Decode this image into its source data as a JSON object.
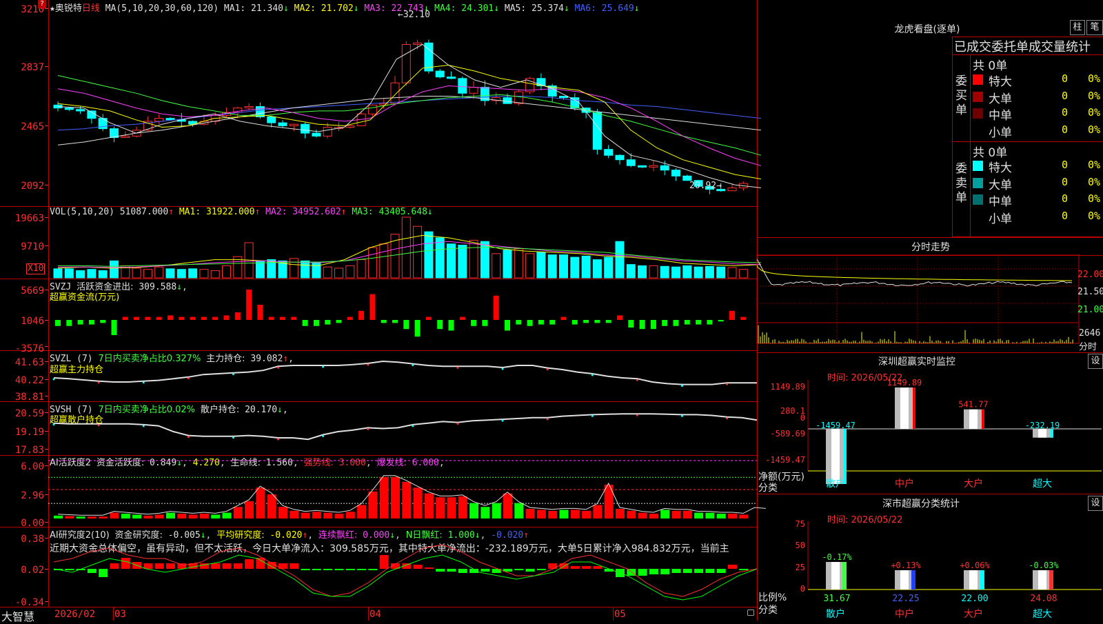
{
  "main": {
    "title_star": "★",
    "stock_name": "奥锐特",
    "period": "日线",
    "ma_label": "MA(5,10,20,30,60,120)",
    "ma": [
      {
        "name": "MA1",
        "value": "21.340",
        "arrow": "↓",
        "color": "#e0e0e0"
      },
      {
        "name": "MA2",
        "value": "21.702",
        "arrow": "↓",
        "color": "#ffff00"
      },
      {
        "name": "MA3",
        "value": "22.743",
        "arrow": "↓",
        "color": "#ff40ff"
      },
      {
        "name": "MA4",
        "value": "24.301",
        "arrow": "↓",
        "color": "#40ff40"
      },
      {
        "name": "MA5",
        "value": "25.374",
        "arrow": "↓",
        "color": "#e0e0e0"
      },
      {
        "name": "MA6",
        "value": "25.649",
        "arrow": "↓",
        "color": "#4060ff"
      }
    ],
    "y_labels": [
      "3210",
      "2837",
      "2465",
      "2092"
    ],
    "max_annot": "32.10",
    "min_annot": "20.92"
  },
  "vol": {
    "label": "VOL(5,10,20)",
    "value": "51087.000",
    "value_arrow": "↑",
    "ma": [
      {
        "name": "MA1",
        "value": "31922.000",
        "arrow": "↑",
        "color": "#ffff00"
      },
      {
        "name": "MA2",
        "value": "34952.602",
        "arrow": "↑",
        "color": "#ff40ff"
      },
      {
        "name": "MA3",
        "value": "43405.648",
        "arrow": "↓",
        "color": "#40ff40"
      }
    ],
    "y_labels": [
      "19663",
      "9710"
    ],
    "unit": "X10"
  },
  "svzj": {
    "label": "SVZJ",
    "text": "活跃资金进出:",
    "value": "309.588",
    "arrow": "↓",
    "sub": "超赢资金流(万元)",
    "y_labels": [
      "5669",
      "1046",
      "-3576"
    ]
  },
  "svzl": {
    "label": "SVZL (7)",
    "text1": "7日内买卖净占比0.327%",
    "text2": "主力持仓:",
    "value": "39.082",
    "arrow": "↑",
    "suffix": ",",
    "sub": "超赢主力持仓",
    "y_labels": [
      "41.63",
      "40.22",
      "38.81"
    ]
  },
  "svsh": {
    "label": "SVSH (7)",
    "text1": "7日内买卖净占比0.02%",
    "text2": "散户持仓:",
    "value": "20.170",
    "arrow": "↓",
    "suffix": ",",
    "sub": "超赢散户持仓",
    "y_labels": [
      "20.59",
      "19.19",
      "17.83"
    ]
  },
  "ai_active": {
    "label": "AI活跃度2",
    "text": "资金活跃度:",
    "v1": "0.849",
    "a1": "↓",
    "v2": "4.270",
    "t2": "生命线:",
    "v3": "1.560",
    "t3": "强势线:",
    "v4": "3.000",
    "t4": "爆发线:",
    "v5": "6.000",
    "y_labels": [
      "6.00",
      "2.96",
      "0.00"
    ]
  },
  "ai_research": {
    "label": "AI研究度2(10)",
    "t1": "资金研究度:",
    "v1": "-0.005",
    "a1": "↓",
    "t2": "平均研究度:",
    "v2": "-0.020",
    "a2": "↑",
    "t3": "连续飘红:",
    "v3": "0.000",
    "a3": "↓",
    "t4": "N日飘红:",
    "v4": "1.000",
    "a4": "↓",
    "v5": "-0.020",
    "a5": "↑",
    "comment": "近期大资金总体偏空，虽有异动，但不太活跃，今日大单净流入：309.585万元，其中特大单净流出：-232.189万元，大单5日累计净入984.832万元，当前主",
    "y_labels": [
      "0.38",
      "0.02",
      "-0.34"
    ]
  },
  "bottom": {
    "brand": "大智慧",
    "date_labels": [
      "2026/02",
      "03",
      "04",
      "05"
    ]
  },
  "dragon": {
    "title": "龙虎看盘(逐单)",
    "btn1": "柱",
    "btn2": "笔",
    "header": "已成交委托单成交量统计",
    "buy_side": "委买单",
    "sell_side": "委卖单",
    "buy_total": "共 0单",
    "sell_total": "共 0单",
    "buy_rows": [
      {
        "label": "特大",
        "count": "0",
        "pct": "0%",
        "color": "#ff0000"
      },
      {
        "label": "大单",
        "count": "0",
        "pct": "0%",
        "color": "#a00000"
      },
      {
        "label": "中单",
        "count": "0",
        "pct": "0%",
        "color": "#700000"
      },
      {
        "label": "小单",
        "count": "0",
        "pct": "0%",
        "color": ""
      }
    ],
    "sell_rows": [
      {
        "label": "特大",
        "count": "0",
        "pct": "0%",
        "color": "#00ffff"
      },
      {
        "label": "大单",
        "count": "0",
        "pct": "0%",
        "color": "#00a0a0"
      },
      {
        "label": "中单",
        "count": "0",
        "pct": "0%",
        "color": "#007070"
      },
      {
        "label": "小单",
        "count": "0",
        "pct": "0%",
        "color": ""
      }
    ]
  },
  "intraday": {
    "title": "分时走势",
    "y_labels": [
      "22.00",
      "21.50",
      "21.00"
    ],
    "vol_label": "2646",
    "vol_unit": "分时"
  },
  "sz_monitor": {
    "title": "深圳超赢实时监控",
    "btn": "设",
    "time": "时间: 2026/05/22",
    "y_labels": [
      "1149.89",
      "280.1",
      "0",
      "-589.69",
      "-1459.47"
    ],
    "axis_title": "净额(万元)",
    "axis_sub": "分类",
    "bars": [
      {
        "cat": "散户",
        "value": -1459.47,
        "label": "-1459.47",
        "color": "#00ffff"
      },
      {
        "cat": "中户",
        "value": 1149.89,
        "label": "1149.89",
        "color": "#ff0000"
      },
      {
        "cat": "大户",
        "value": 541.77,
        "label": "541.77",
        "color": "#ff0000"
      },
      {
        "cat": "超大",
        "value": -232.19,
        "label": "-232.19",
        "color": "#00ffff"
      }
    ],
    "cat_colors": [
      "#00ffff",
      "#ff3030",
      "#ff3030",
      "#00ffff"
    ]
  },
  "sz_class": {
    "title": "深市超赢分类统计",
    "btn": "设",
    "time": "时间: 2026/05/22",
    "y_labels": [
      "75",
      "50",
      "25",
      "0"
    ],
    "axis_title": "比例%",
    "axis_sub": "分类",
    "bars": [
      {
        "cat": "散户",
        "value": 31.67,
        "label": "31.67",
        "change": "-0.17%",
        "color": "#40ff40"
      },
      {
        "cat": "中户",
        "value": 22.25,
        "label": "22.25",
        "change": "+0.13%",
        "color": "#2040ff"
      },
      {
        "cat": "大户",
        "value": 22.0,
        "label": "22.00",
        "change": "+0.06%",
        "color": "#00ffff"
      },
      {
        "cat": "超大",
        "value": 24.08,
        "label": "24.08",
        "change": "-0.03%",
        "color": "#ff3030"
      }
    ]
  }
}
